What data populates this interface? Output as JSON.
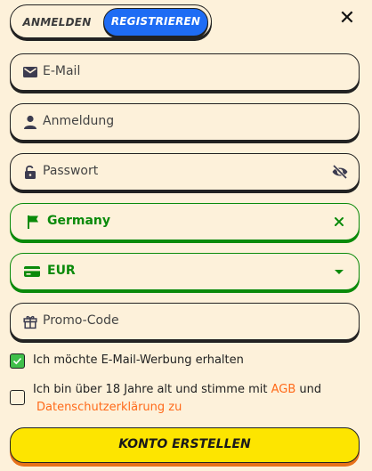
{
  "tabs": {
    "login": "ANMELDEN",
    "register": "REGISTRIEREN",
    "active": "register"
  },
  "close_label": "✕",
  "fields": {
    "email": {
      "placeholder": "E-Mail",
      "icon": "envelope-icon"
    },
    "username": {
      "placeholder": "Anmeldung",
      "icon": "user-icon"
    },
    "password": {
      "placeholder": "Passwort",
      "icon": "lock-open-icon",
      "toggle_icon": "eye-off-icon"
    },
    "country": {
      "value": "Germany",
      "icon": "flag-icon",
      "clear_icon": "close-icon"
    },
    "currency": {
      "value": "EUR",
      "icon": "credit-card-icon",
      "dropdown_icon": "caret-down-icon"
    },
    "promo": {
      "placeholder": "Promo-Code",
      "icon": "gift-icon"
    }
  },
  "checkboxes": {
    "email_ads": {
      "label": "Ich möchte E-Mail-Werbung erhalten",
      "checked": true
    },
    "age_terms": {
      "label_line1": "Ich bin über 18 Jahre alt und stimme mit",
      "link1": "AGB",
      "conjunction": "und",
      "link2": "Datenschutzerklärung zu",
      "checked": false
    }
  },
  "submit_label": "KONTO ERSTELLEN",
  "colors": {
    "background": "#fdf1da",
    "accent_blue": "#1e6cf4",
    "valid_green": "#0a8a0a",
    "checkbox_green": "#3fbf4a",
    "submit_yellow": "#fde500",
    "link_orange": "#ff6a1a"
  }
}
